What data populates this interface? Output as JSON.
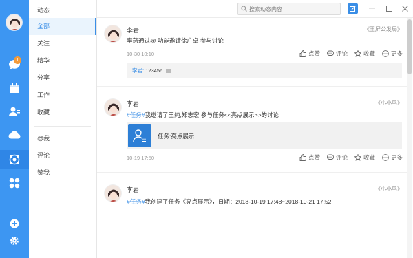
{
  "rail": {
    "badge_count": "1",
    "accent": "#3d96f2",
    "icons": [
      "chat-icon",
      "calendar-icon",
      "contacts-icon",
      "cloud-icon",
      "apps-icon",
      "grid-icon",
      "add-icon",
      "settings-icon"
    ]
  },
  "sidebar": {
    "title": "动态",
    "items": [
      {
        "label": "全部"
      },
      {
        "label": "关注"
      },
      {
        "label": "精华"
      },
      {
        "label": "分享"
      },
      {
        "label": "工作"
      },
      {
        "label": "收藏"
      },
      {
        "label": "@我"
      },
      {
        "label": "评论"
      },
      {
        "label": "赞我"
      }
    ]
  },
  "header": {
    "search_placeholder": "搜索动态内容"
  },
  "posts": [
    {
      "author": "李岩",
      "group": "《王屏公发局》",
      "text": "李燕通过@ 功能邀请徐广卓 参与讨论",
      "time": "10-30 10:10",
      "comment": {
        "who": "李岩:",
        "text": "123456"
      },
      "actions": {
        "like": "点赞",
        "comment": "评论",
        "fav": "收藏",
        "more": "更多"
      }
    },
    {
      "author": "李岩",
      "group": "《小小鸟》",
      "tag": "#任务#",
      "text": "我邀请了王纯,郑志宏 参与任务<<亮点展示>>的讨论",
      "task_label": "任务:亮点展示",
      "time": "10-19 17:50",
      "actions": {
        "like": "点赞",
        "comment": "评论",
        "fav": "收藏",
        "more": "更多"
      }
    },
    {
      "author": "李岩",
      "group": "《小小鸟》",
      "tag": "#任务#",
      "text": "我创建了任务《亮点展示》，日期：2018-10-19 17:48~2018-10-21 17:52"
    }
  ]
}
